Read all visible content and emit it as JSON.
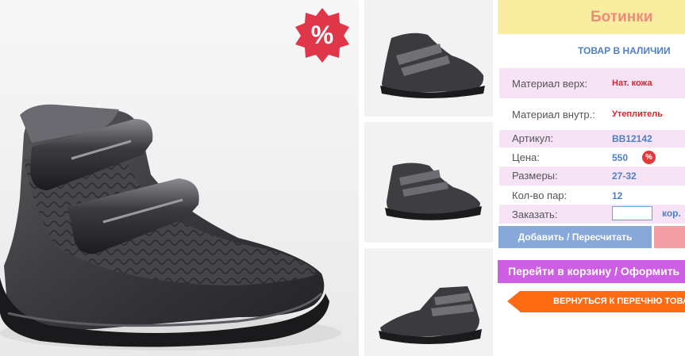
{
  "product": {
    "title": "Ботинки",
    "stock_status": "ТОВАР В НАЛИЧИИ",
    "sale_badge": "%",
    "details": [
      {
        "label": "Материал верх:",
        "value": "Нат. кожа"
      },
      {
        "label": "Материал внутр.:",
        "value": "Утеплитель"
      },
      {
        "label": "Артикул:",
        "value": "BB12142"
      },
      {
        "label": "Цена:",
        "value": "550"
      },
      {
        "label": "Размеры:",
        "value": "27-32"
      },
      {
        "label": "Кол-во пар:",
        "value": "12"
      }
    ],
    "price_discount_icon": "%",
    "order": {
      "label": "Заказать:",
      "quantity_value": "",
      "unit": "кор."
    }
  },
  "actions": {
    "add_recalc": "Добавить / Пересчитать",
    "go_to_cart": "Перейти в корзину / Оформить",
    "back_to_list": "ВЕРНУТЬСЯ К ПЕРЕЧНЮ ТОВАРОВ"
  },
  "colors": {
    "title_bg": "#f9eda0",
    "title_text": "#f08a7a",
    "accent_blue": "#4f7fc4",
    "value_red": "#d8262f",
    "cart_purple": "#cc5fe3",
    "back_orange": "#ff6b12",
    "sale_red": "#e0364a"
  }
}
